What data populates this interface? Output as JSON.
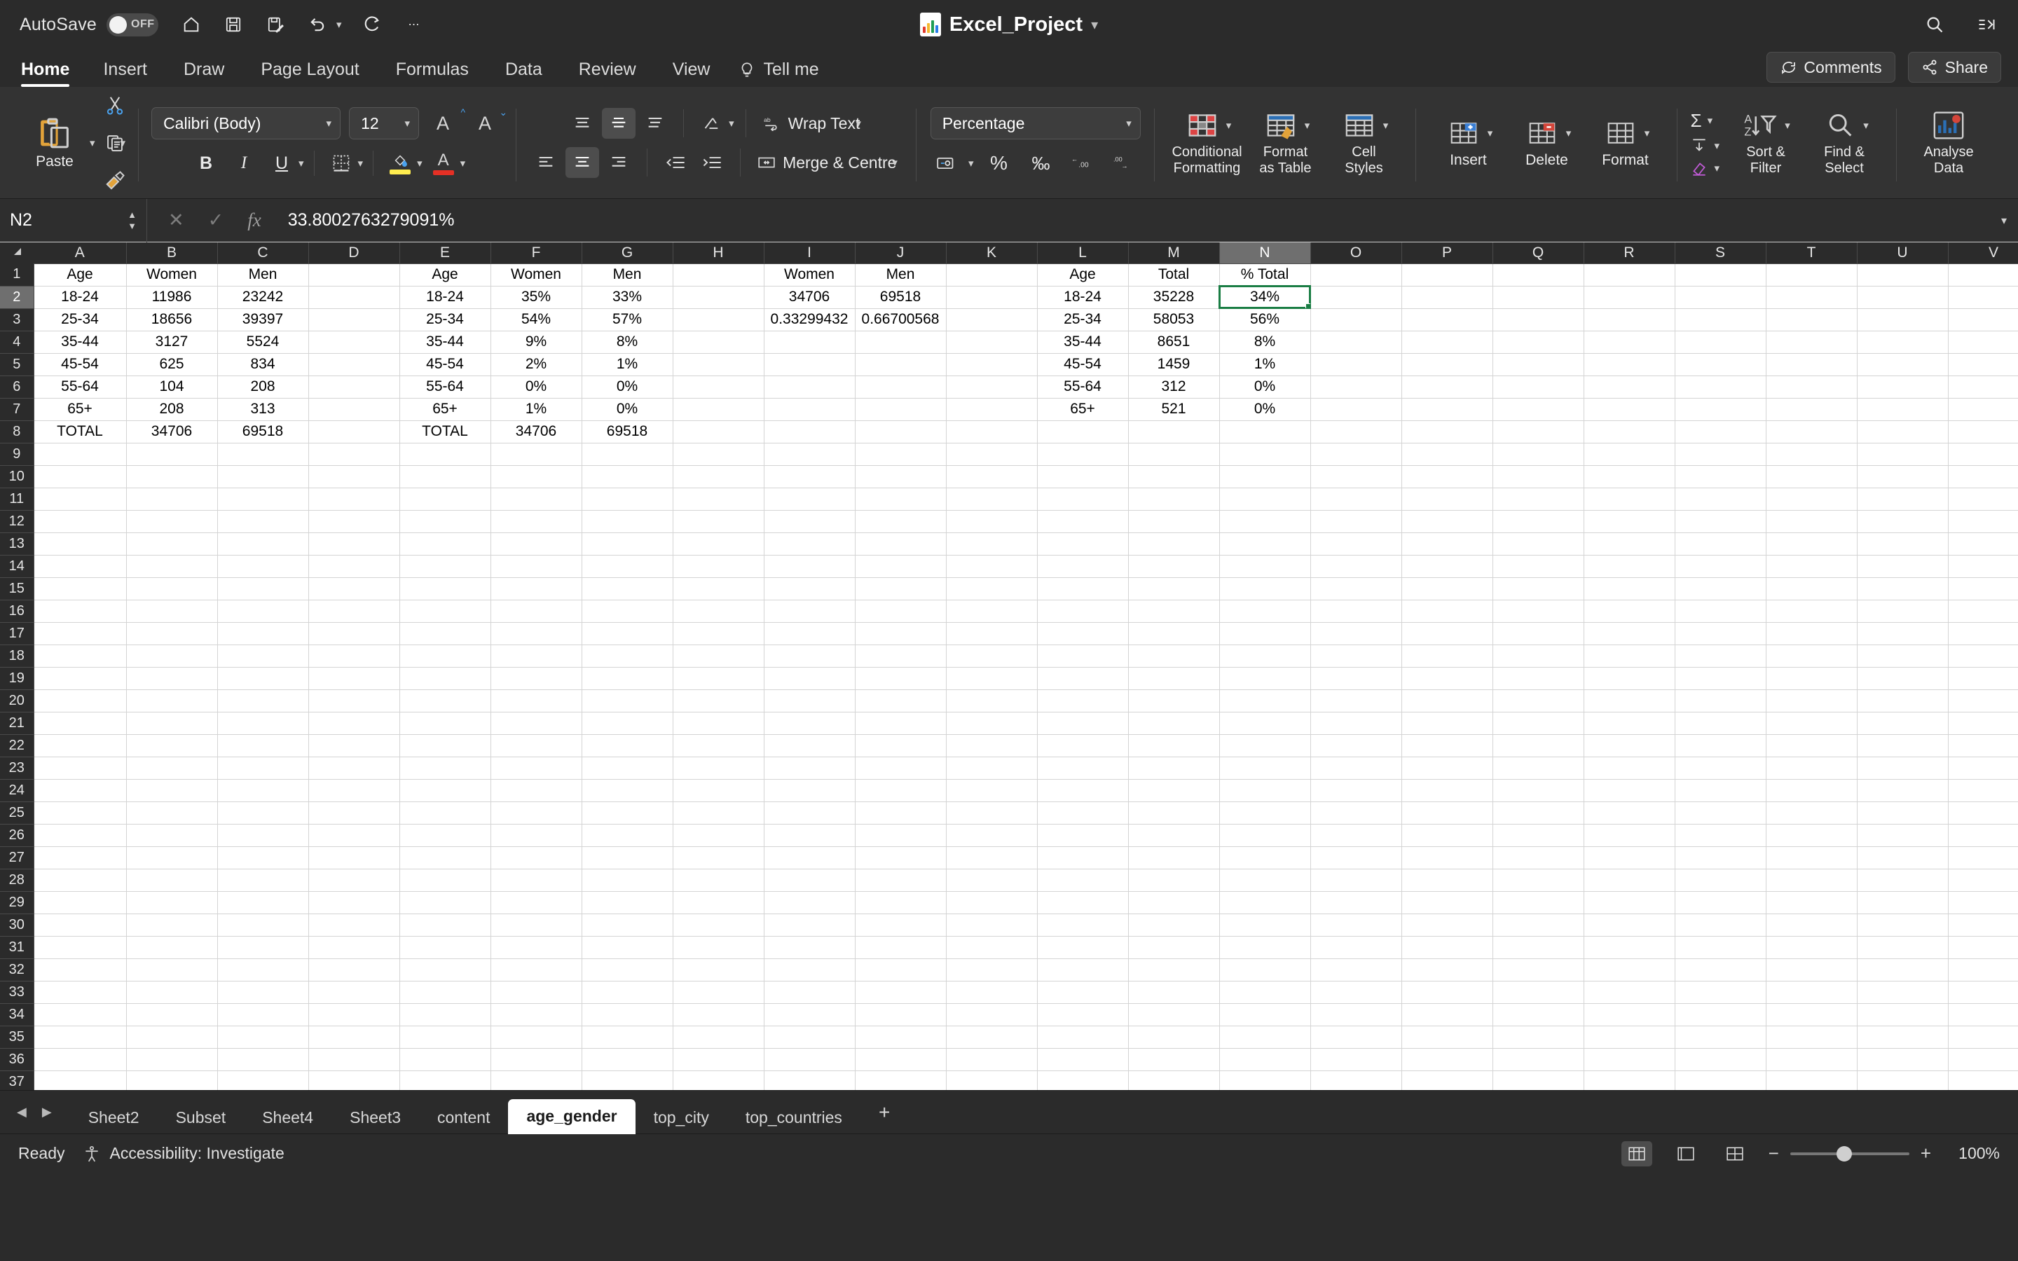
{
  "titlebar": {
    "autosave_label": "AutoSave",
    "autosave_state": "OFF",
    "document_title": "Excel_Project",
    "quick_access": [
      "home-icon",
      "save-icon",
      "save-as-icon",
      "undo-icon",
      "redo-icon",
      "more-options-icon"
    ],
    "right_icons": [
      "search-icon",
      "ribbon-display-icon"
    ]
  },
  "ribbon_tabs": {
    "items": [
      {
        "label": "Home",
        "active": true
      },
      {
        "label": "Insert",
        "active": false
      },
      {
        "label": "Draw",
        "active": false
      },
      {
        "label": "Page Layout",
        "active": false
      },
      {
        "label": "Formulas",
        "active": false
      },
      {
        "label": "Data",
        "active": false
      },
      {
        "label": "Review",
        "active": false
      },
      {
        "label": "View",
        "active": false
      }
    ],
    "tell_me": "Tell me",
    "comments": "Comments",
    "share": "Share"
  },
  "ribbon": {
    "paste_label": "Paste",
    "font_name": "Calibri (Body)",
    "font_size": "12",
    "increase_font": "A",
    "decrease_font": "A",
    "bold": "B",
    "italic": "I",
    "underline": "U",
    "wrap_text": "Wrap Text",
    "merge_centre": "Merge & Centre",
    "number_format": "Percentage",
    "percent_symbol": "%",
    "comma_symbol": "‰",
    "increase_decimal": ".00",
    "decrease_decimal": ".00",
    "conditional_formatting": "Conditional\nFormatting",
    "conditional_formatting_l1": "Conditional",
    "conditional_formatting_l2": "Formatting",
    "format_as_table_l1": "Format",
    "format_as_table_l2": "as Table",
    "cell_styles_l1": "Cell",
    "cell_styles_l2": "Styles",
    "insert": "Insert",
    "delete": "Delete",
    "format": "Format",
    "autosum": "Σ",
    "fill": "⬇",
    "clear": "◇",
    "sort_filter_l1": "Sort &",
    "sort_filter_l2": "Filter",
    "find_select_l1": "Find &",
    "find_select_l2": "Select",
    "analyse_data_l1": "Analyse",
    "analyse_data_l2": "Data"
  },
  "formula_bar": {
    "name_box": "N2",
    "cancel_icon": "✕",
    "enter_icon": "✓",
    "fx_icon": "fx",
    "formula_value": "33.8002763279091%"
  },
  "grid": {
    "columns": [
      "A",
      "B",
      "C",
      "D",
      "E",
      "F",
      "G",
      "H",
      "I",
      "J",
      "K",
      "L",
      "M",
      "N",
      "O",
      "P",
      "Q",
      "R",
      "S",
      "T",
      "U",
      "V"
    ],
    "active_column": "N",
    "active_row": 2,
    "selected_cell": "N2",
    "row_count": 41,
    "rows": [
      {
        "n": 1,
        "cells": {
          "A": "Age",
          "B": "Women",
          "C": "Men",
          "E": "Age",
          "F": "Women",
          "G": "Men",
          "I": "Women",
          "J": "Men",
          "L": "Age",
          "M": "Total",
          "N": "% Total"
        }
      },
      {
        "n": 2,
        "cells": {
          "A": "18-24",
          "B": "11986",
          "C": "23242",
          "E": "18-24",
          "F": "35%",
          "G": "33%",
          "I": "34706",
          "J": "69518",
          "L": "18-24",
          "M": "35228",
          "N": "34%"
        }
      },
      {
        "n": 3,
        "cells": {
          "A": "25-34",
          "B": "18656",
          "C": "39397",
          "E": "25-34",
          "F": "54%",
          "G": "57%",
          "I": "0.33299432",
          "J": "0.66700568",
          "L": "25-34",
          "M": "58053",
          "N": "56%"
        }
      },
      {
        "n": 4,
        "cells": {
          "A": "35-44",
          "B": "3127",
          "C": "5524",
          "E": "35-44",
          "F": "9%",
          "G": "8%",
          "L": "35-44",
          "M": "8651",
          "N": "8%"
        }
      },
      {
        "n": 5,
        "cells": {
          "A": "45-54",
          "B": "625",
          "C": "834",
          "E": "45-54",
          "F": "2%",
          "G": "1%",
          "L": "45-54",
          "M": "1459",
          "N": "1%"
        }
      },
      {
        "n": 6,
        "cells": {
          "A": "55-64",
          "B": "104",
          "C": "208",
          "E": "55-64",
          "F": "0%",
          "G": "0%",
          "L": "55-64",
          "M": "312",
          "N": "0%"
        }
      },
      {
        "n": 7,
        "cells": {
          "A": "65+",
          "B": "208",
          "C": "313",
          "E": "65+",
          "F": "1%",
          "G": "0%",
          "L": "65+",
          "M": "521",
          "N": "0%"
        }
      },
      {
        "n": 8,
        "cells": {
          "A": "TOTAL",
          "B": "34706",
          "C": "69518",
          "E": "TOTAL",
          "F": "34706",
          "G": "69518"
        }
      }
    ]
  },
  "sheet_tabs": {
    "items": [
      {
        "label": "Sheet2",
        "active": false
      },
      {
        "label": "Subset",
        "active": false
      },
      {
        "label": "Sheet4",
        "active": false
      },
      {
        "label": "Sheet3",
        "active": false
      },
      {
        "label": "content",
        "active": false
      },
      {
        "label": "age_gender",
        "active": true
      },
      {
        "label": "top_city",
        "active": false
      },
      {
        "label": "top_countries",
        "active": false
      }
    ],
    "add_label": "+"
  },
  "status_bar": {
    "ready": "Ready",
    "accessibility": "Accessibility: Investigate",
    "zoom_level": "100%"
  },
  "colors": {
    "accent_green": "#1a7d44",
    "chrome_dark": "#2b2b2b",
    "ribbon_bg": "#333333"
  }
}
